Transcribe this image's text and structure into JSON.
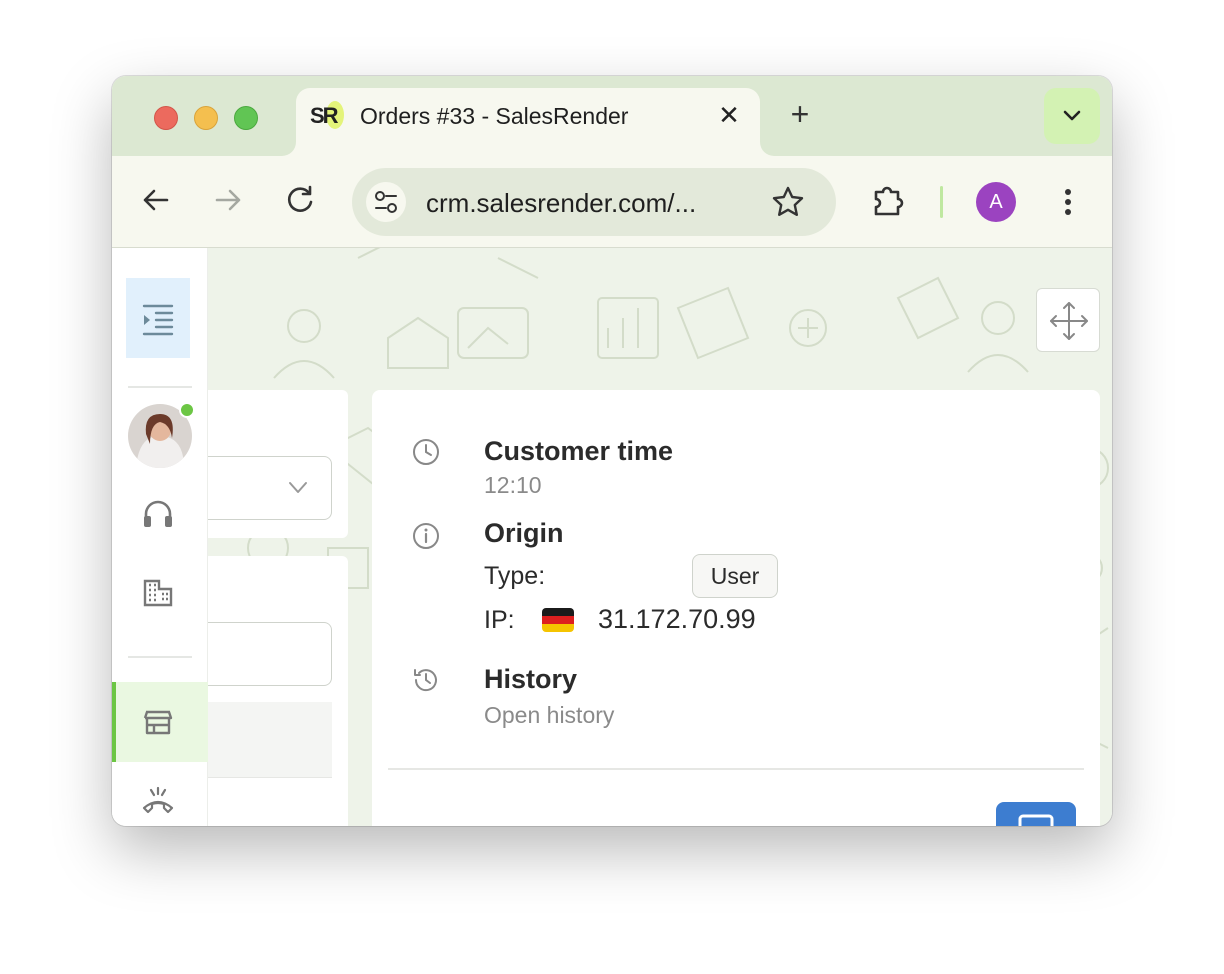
{
  "browser": {
    "tab": {
      "favicon_text": "SR",
      "title": "Orders #33 - SalesRender",
      "close_glyph": "✕"
    },
    "new_tab_glyph": "+",
    "tab_search_glyph": "⌄",
    "url": "crm.salesrender.com/...",
    "profile_initial": "A",
    "accent_color": "#dce8d2"
  },
  "rail": {
    "items": [
      {
        "name": "collapse-menu-icon"
      },
      {
        "name": "user-avatar",
        "status": "online"
      },
      {
        "name": "headset-icon"
      },
      {
        "name": "building-icon"
      },
      {
        "name": "store-icon",
        "selected": true
      },
      {
        "name": "phone-hangup-icon"
      }
    ]
  },
  "order_info": {
    "customer_time_label": "Customer time",
    "customer_time_value": "12:10",
    "origin_label": "Origin",
    "type_label": "Type:",
    "type_value": "User",
    "ip_label": "IP:",
    "ip_country_flag": "DE",
    "ip_value": "31.172.70.99",
    "history_label": "History",
    "history_link": "Open history"
  },
  "colors": {
    "primary_button": "#3d7dd0",
    "online_status": "#6cc644",
    "selected_rail": "#eaf8e1"
  }
}
